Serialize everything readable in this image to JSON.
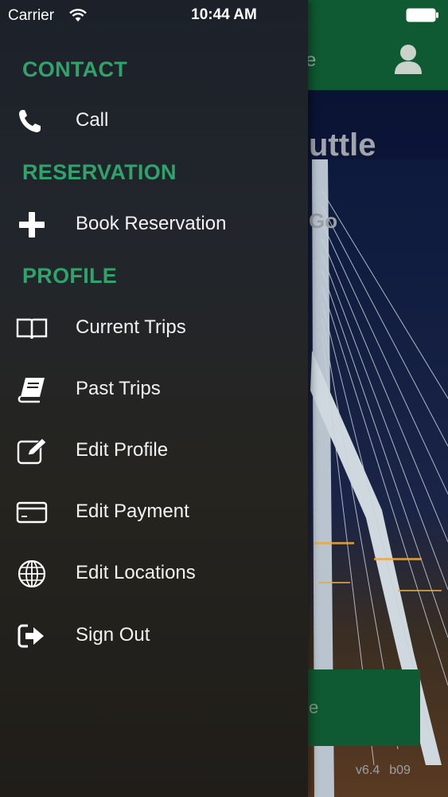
{
  "status_bar": {
    "carrier": "Carrier",
    "time": "10:44 AM"
  },
  "background_app": {
    "header_title_fragment": "e",
    "hero_title_fragment": "uttle",
    "hero_subtitle_fragment": "Go",
    "button_label_fragment": "e",
    "version": "v6.4",
    "build": "b09"
  },
  "drawer": {
    "sections": [
      {
        "title": "CONTACT",
        "items": [
          {
            "label": "Call",
            "icon": "phone-icon"
          }
        ]
      },
      {
        "title": "RESERVATION",
        "items": [
          {
            "label": "Book Reservation",
            "icon": "plus-icon"
          }
        ]
      },
      {
        "title": "PROFILE",
        "items": [
          {
            "label": "Current Trips",
            "icon": "open-book-icon"
          },
          {
            "label": "Past Trips",
            "icon": "closed-book-icon"
          },
          {
            "label": "Edit Profile",
            "icon": "edit-icon"
          },
          {
            "label": "Edit Payment",
            "icon": "credit-card-icon"
          },
          {
            "label": "Edit Locations",
            "icon": "globe-icon"
          },
          {
            "label": "Sign Out",
            "icon": "sign-out-icon"
          }
        ]
      }
    ]
  },
  "colors": {
    "accent": "#2fa36a",
    "header_green": "#0f5a32",
    "drawer_bg": "#22262c",
    "text": "#f2f2f2"
  }
}
